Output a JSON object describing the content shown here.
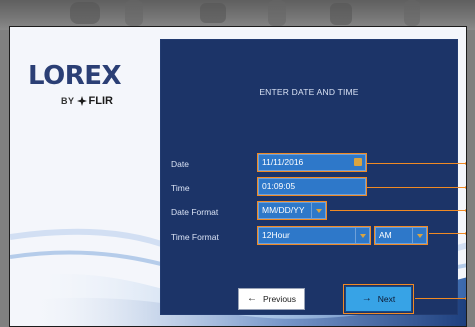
{
  "branding": {
    "logo_word": "LOREX",
    "logo_by": "BY",
    "logo_flir": "FLIR"
  },
  "dialog": {
    "title": "ENTER DATE AND TIME",
    "rows": [
      {
        "label": "Date",
        "value": "11/11/2016",
        "icon": "calendar-icon"
      },
      {
        "label": "Time",
        "value": "01:09:05"
      },
      {
        "label": "Date Format",
        "value": "MM/DD/YY"
      },
      {
        "label": "Time Format",
        "value": "12Hour",
        "ampm": "AM"
      }
    ]
  },
  "buttons": {
    "previous": {
      "label": "Previous",
      "icon": "arrow-left-icon"
    },
    "next": {
      "label": "Next",
      "icon": "arrow-right-icon"
    }
  },
  "colors": {
    "panel_bg": "#1c3468",
    "field_bg": "#2e78c9",
    "highlight": "#f08a24",
    "next_bg": "#37a3e6"
  }
}
